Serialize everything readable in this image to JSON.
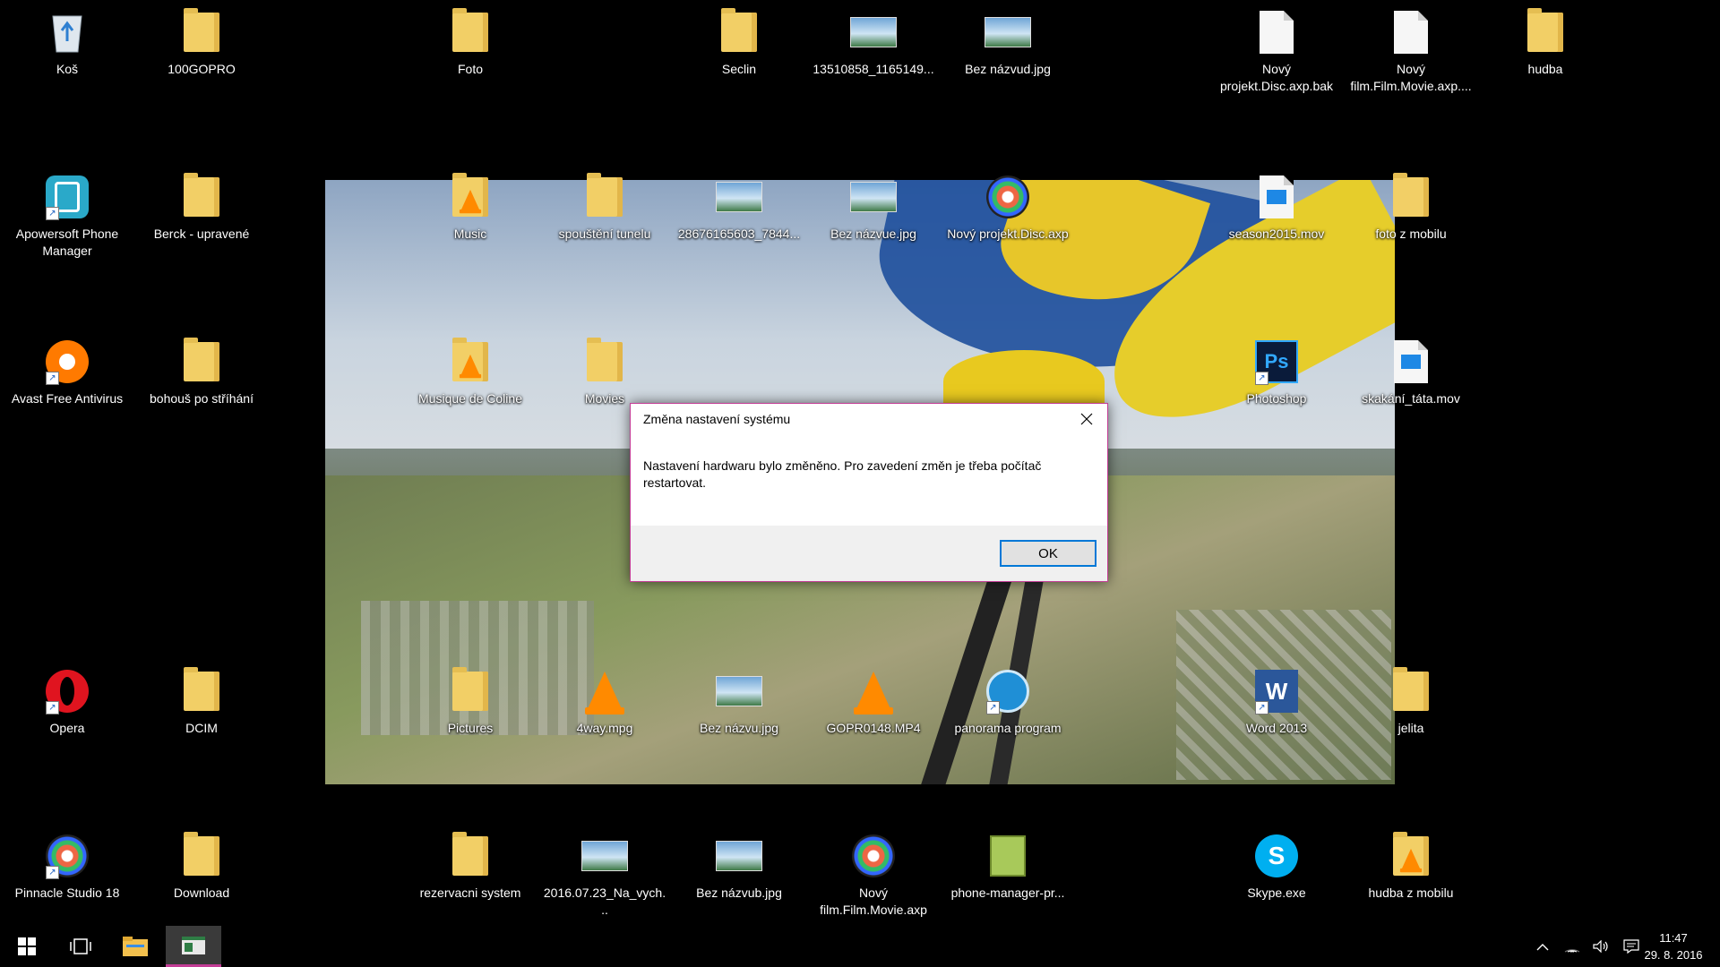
{
  "desktop_icons": [
    {
      "label": "Koš",
      "icon": "recycle-bin-icon"
    },
    {
      "label": "100GOPRO",
      "icon": "folder-icon"
    },
    {
      "label": "Foto",
      "icon": "folder-icon"
    },
    {
      "label": "Seclin",
      "icon": "folder-icon"
    },
    {
      "label": "13510858_1165149...",
      "icon": "image-file-icon"
    },
    {
      "label": "Bez názvud.jpg",
      "icon": "image-file-icon"
    },
    {
      "label": "Nový projekt.Disc.axp.bak",
      "icon": "blank-file-icon"
    },
    {
      "label": "Nový film.Film.Movie.axp....",
      "icon": "blank-file-icon"
    },
    {
      "label": "hudba",
      "icon": "folder-icon"
    },
    {
      "label": "Apowersoft Phone Manager",
      "icon": "apowersoft-icon"
    },
    {
      "label": "Berck - upravené",
      "icon": "folder-icon"
    },
    {
      "label": "Music",
      "icon": "vlc-folder-icon"
    },
    {
      "label": "spouštění tunelu",
      "icon": "folder-icon"
    },
    {
      "label": "28676165603_7844...",
      "icon": "image-file-icon"
    },
    {
      "label": "Bez názvue.jpg",
      "icon": "image-file-icon"
    },
    {
      "label": "Nový projekt.Disc.axp",
      "icon": "pinnacle-icon"
    },
    {
      "label": "season2015.mov",
      "icon": "video-file-icon"
    },
    {
      "label": "foto z mobilu",
      "icon": "folder-icon"
    },
    {
      "label": "Avast Free Antivirus",
      "icon": "avast-icon"
    },
    {
      "label": "bohouš po stříhání",
      "icon": "folder-icon"
    },
    {
      "label": "Musique de Coline",
      "icon": "vlc-folder-icon"
    },
    {
      "label": "Movies",
      "icon": "folder-icon"
    },
    {
      "label": "Photoshop",
      "icon": "photoshop-icon"
    },
    {
      "label": "skakání_táta.mov",
      "icon": "video-file-icon"
    },
    {
      "label": "Opera",
      "icon": "opera-icon"
    },
    {
      "label": "DCIM",
      "icon": "folder-icon"
    },
    {
      "label": "Pictures",
      "icon": "folder-icon"
    },
    {
      "label": "4way.mpg",
      "icon": "vlc-icon"
    },
    {
      "label": "Bez názvu.jpg",
      "icon": "image-file-icon"
    },
    {
      "label": "GOPR0148.MP4",
      "icon": "vlc-icon"
    },
    {
      "label": "panorama program",
      "icon": "panorama-icon"
    },
    {
      "label": "Word 2013",
      "icon": "word-icon"
    },
    {
      "label": "jelita",
      "icon": "folder-icon"
    },
    {
      "label": "Pinnacle Studio 18",
      "icon": "pinnacle-icon"
    },
    {
      "label": "Download",
      "icon": "folder-icon"
    },
    {
      "label": "rezervacni system",
      "icon": "folder-icon"
    },
    {
      "label": "2016.07.23_Na_vych...",
      "icon": "image-file-icon"
    },
    {
      "label": "Bez názvub.jpg",
      "icon": "image-file-icon"
    },
    {
      "label": "Nový film.Film.Movie.axp",
      "icon": "pinnacle-icon"
    },
    {
      "label": "phone-manager-pr...",
      "icon": "installer-icon"
    },
    {
      "label": "Skype.exe",
      "icon": "skype-icon"
    },
    {
      "label": "hudba z mobilu",
      "icon": "vlc-folder-icon"
    }
  ],
  "dialog": {
    "title": "Změna nastavení systému",
    "message": "Nastavení hardwaru bylo změněno. Pro zavedení změn je třeba počítač restartovat.",
    "ok_label": "OK",
    "accent_color": "#c33d96"
  },
  "taskbar": {
    "start": "windows-start-icon",
    "task_view": "task-view-icon",
    "file_explorer": "file-explorer-icon",
    "active_app": "system-dialog-app-icon",
    "tray": [
      "chevron-up-icon",
      "wifi-icon",
      "volume-icon",
      "action-center-icon"
    ],
    "time": "11:47",
    "date": "29. 8. 2016"
  }
}
